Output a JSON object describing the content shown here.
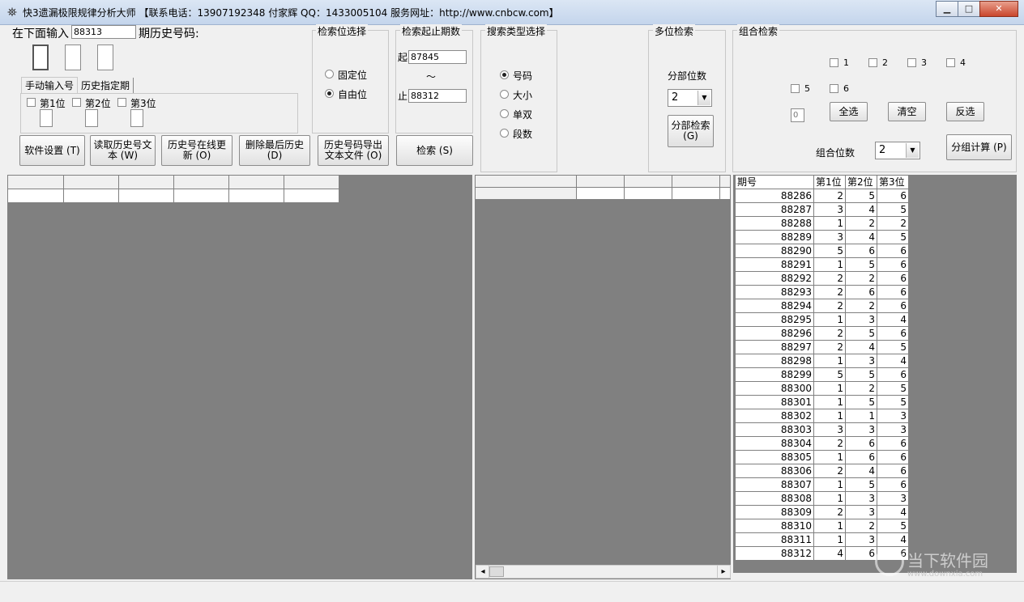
{
  "window": {
    "title": "快3遗漏极限规律分析大师 【联系电话：13907192348 付家辉 QQ：1433005104 服务网址：http://www.cnbcw.com】",
    "controls": {
      "minimize": "▁",
      "maximize": "□",
      "close": "✕"
    }
  },
  "input_section": {
    "prefix": "在下面输入",
    "period_value": "88313",
    "suffix": "期历史号码:",
    "tabs": [
      "手动输入号",
      "历史指定期"
    ],
    "positions": [
      "第1位",
      "第2位",
      "第3位"
    ]
  },
  "search_pos_group": {
    "title": "检索位选择",
    "options": [
      "固定位",
      "自由位"
    ],
    "selected": 1
  },
  "period_range_group": {
    "title": "检索起止期数",
    "start_label": "起",
    "start_value": "87845",
    "tilde": "～",
    "end_label": "止",
    "end_value": "88312",
    "search_button": "检索 (S)"
  },
  "search_type_group": {
    "title": "搜索类型选择",
    "options": [
      "号码",
      "大小",
      "单双",
      "段数"
    ],
    "selected": 0
  },
  "multi_search_group": {
    "title": "多位检索",
    "count_label": "分部位数",
    "count_value": "2",
    "button_line1": "分部检索",
    "button_line2": "(G)"
  },
  "combo_group": {
    "title": "组合检索",
    "checks": [
      "1",
      "2",
      "3",
      "4",
      "5",
      "6"
    ],
    "count_field": "0",
    "select_all": "全选",
    "clear": "清空",
    "invert": "反选",
    "combo_label": "组合位数",
    "combo_value": "2",
    "calc_button": "分组计算 (P)"
  },
  "toolbar": {
    "settings_button": "软件设置 (T)",
    "read_line1": "读取历史号文",
    "read_line2": "本 (W)",
    "update_line1": "历史号在线更",
    "update_line2": "新 (O)",
    "delete_line1": "删除最后历史",
    "delete_line2": "(D)",
    "export_line1": "历史号码导出",
    "export_line2": "文本文件 (O)"
  },
  "history_table": {
    "headers": [
      "期号",
      "第1位",
      "第2位",
      "第3位"
    ],
    "rows": [
      [
        "88286",
        "2",
        "5",
        "6"
      ],
      [
        "88287",
        "3",
        "4",
        "5"
      ],
      [
        "88288",
        "1",
        "2",
        "2"
      ],
      [
        "88289",
        "3",
        "4",
        "5"
      ],
      [
        "88290",
        "5",
        "6",
        "6"
      ],
      [
        "88291",
        "1",
        "5",
        "6"
      ],
      [
        "88292",
        "2",
        "2",
        "6"
      ],
      [
        "88293",
        "2",
        "6",
        "6"
      ],
      [
        "88294",
        "2",
        "2",
        "6"
      ],
      [
        "88295",
        "1",
        "3",
        "4"
      ],
      [
        "88296",
        "2",
        "5",
        "6"
      ],
      [
        "88297",
        "2",
        "4",
        "5"
      ],
      [
        "88298",
        "1",
        "3",
        "4"
      ],
      [
        "88299",
        "5",
        "5",
        "6"
      ],
      [
        "88300",
        "1",
        "2",
        "5"
      ],
      [
        "88301",
        "1",
        "5",
        "5"
      ],
      [
        "88302",
        "1",
        "1",
        "3"
      ],
      [
        "88303",
        "3",
        "3",
        "3"
      ],
      [
        "88304",
        "2",
        "6",
        "6"
      ],
      [
        "88305",
        "1",
        "6",
        "6"
      ],
      [
        "88306",
        "2",
        "4",
        "6"
      ],
      [
        "88307",
        "1",
        "5",
        "6"
      ],
      [
        "88308",
        "1",
        "3",
        "3"
      ],
      [
        "88309",
        "2",
        "3",
        "4"
      ],
      [
        "88310",
        "1",
        "2",
        "5"
      ],
      [
        "88311",
        "1",
        "3",
        "4"
      ],
      [
        "88312",
        "4",
        "6",
        "6"
      ]
    ]
  },
  "watermark": {
    "text": "当下软件园",
    "url": "www.downxia.com"
  },
  "scroll": {
    "left": "◂",
    "right": "▸"
  }
}
